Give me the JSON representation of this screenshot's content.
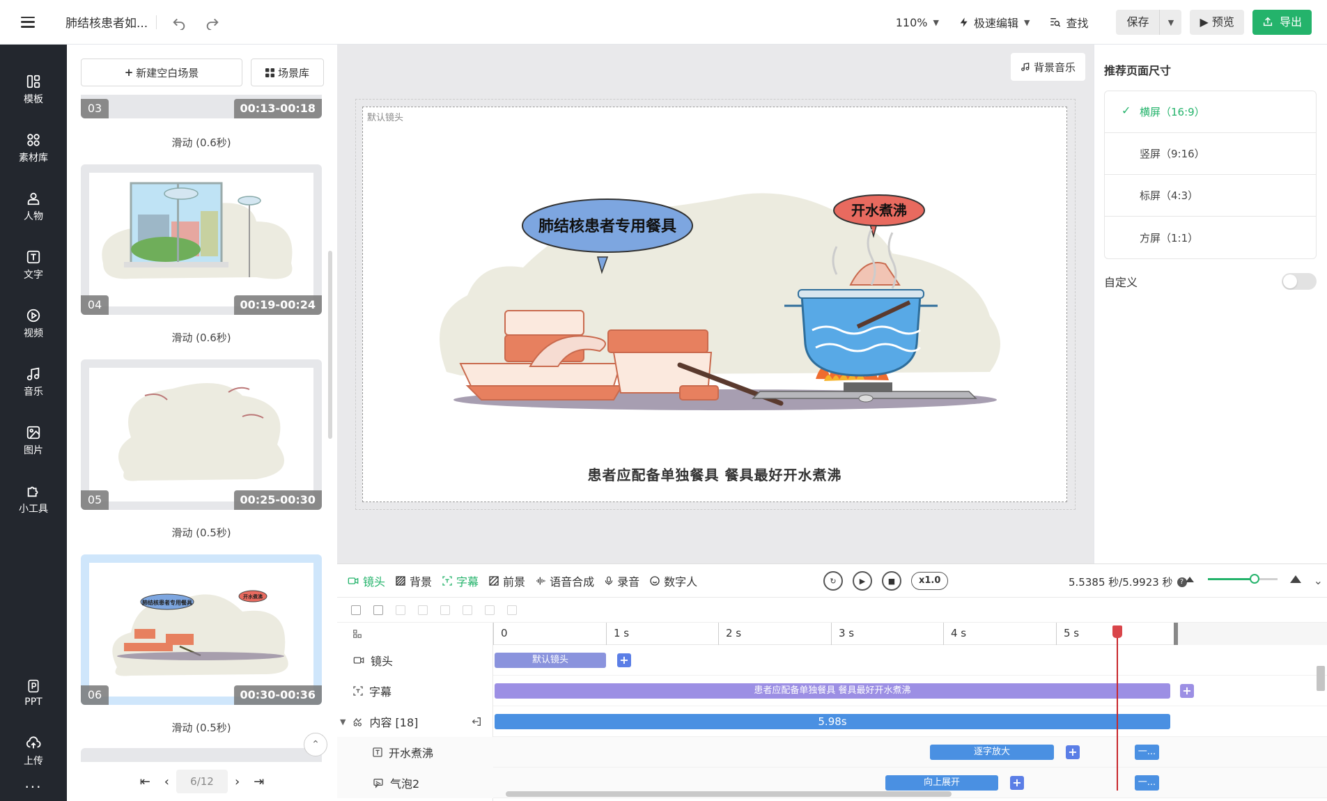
{
  "topbar": {
    "doc_title": "肺结核患者如...",
    "zoom": "110%",
    "edit_mode": "极速编辑",
    "find": "查找",
    "save": "保存",
    "preview": "预览",
    "export": "导出"
  },
  "rail": {
    "items": [
      {
        "label": "模板",
        "icon": "template-icon"
      },
      {
        "label": "素材库",
        "icon": "grid-icon"
      },
      {
        "label": "人物",
        "icon": "person-icon"
      },
      {
        "label": "文字",
        "icon": "text-icon"
      },
      {
        "label": "视频",
        "icon": "video-icon"
      },
      {
        "label": "音乐",
        "icon": "music-icon"
      },
      {
        "label": "图片",
        "icon": "image-icon"
      },
      {
        "label": "小工具",
        "icon": "puzzle-icon"
      }
    ],
    "ppt": "PPT",
    "upload": "上传",
    "more": "···"
  },
  "scenes": {
    "new_blank": "新建空白场景",
    "library": "场景库",
    "cards": [
      {
        "num": "03",
        "time": "00:13-00:18",
        "transition": "滑动 (0.6秒)"
      },
      {
        "num": "04",
        "time": "00:19-00:24",
        "transition": "滑动 (0.6秒)"
      },
      {
        "num": "05",
        "time": "00:25-00:30",
        "transition": "滑动 (0.5秒)"
      },
      {
        "num": "06",
        "time": "00:30-00:36",
        "transition": "滑动 (0.5秒)"
      }
    ],
    "page": "6/12",
    "thumb06": {
      "bubble_left": "肺结核患者专用餐具",
      "bubble_right": "开水煮沸"
    }
  },
  "canvas": {
    "bgm": "背景音乐",
    "camera_label": "默认镜头",
    "bubble_left": "肺结核患者专用餐具",
    "bubble_right": "开水煮沸",
    "subtitle": "患者应配备单独餐具 餐具最好开水煮沸"
  },
  "rpanel": {
    "title": "推荐页面尺寸",
    "sizes": [
      "横屏（16:9）",
      "竖屏（9:16）",
      "标屏（4:3）",
      "方屏（1:1）"
    ],
    "selected": "横屏（16:9）",
    "custom": "自定义"
  },
  "timeline": {
    "tabs": [
      "镜头",
      "背景",
      "字幕",
      "前景",
      "语音合成",
      "录音",
      "数字人"
    ],
    "speed": "x1.0",
    "time": "5.5385 秒/5.9923 秒",
    "ruler": [
      "0",
      "1 s",
      "2 s",
      "3 s",
      "4 s",
      "5 s"
    ],
    "tracks": {
      "camera": "镜头",
      "subtitle": "字幕",
      "content": "内容 [18]",
      "item1": "开水煮沸",
      "item2": "气泡2"
    },
    "bars": {
      "camera": "默认镜头",
      "subtitle": "患者应配备单独餐具 餐具最好开水煮沸",
      "content": "5.98s",
      "item1": "逐字放大",
      "item1_end": "一...",
      "item2": "向上展开",
      "item2_end": "一..."
    }
  }
}
